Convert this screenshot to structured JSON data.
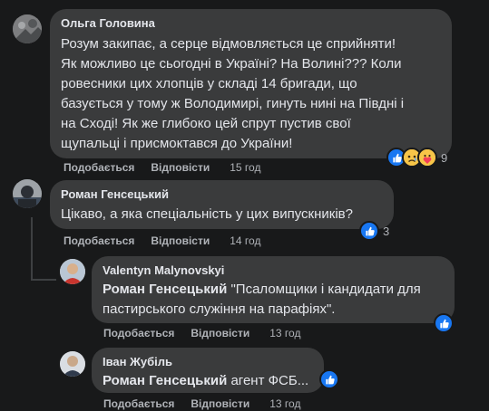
{
  "comments": [
    {
      "author": "Ольга Головина",
      "lines": [
        "Розум закипає, а серце відмовляється це сприйняти!",
        "Як можливо це сьогодні в Україні? На Волині??? Коли",
        "ровесники цих хлопців у складі 14 бригади, що",
        "базується у тому ж Володимирі, гинуть нині на Півдні і",
        "на Сході! Як же глибоко цей спрут пустив свої",
        "щупальці і присмоктався до України!"
      ],
      "like_label": "Подобається",
      "reply_label": "Відповісти",
      "time": "15 год",
      "reaction_count": "9"
    },
    {
      "author": "Роман Генсецький",
      "text": "Цікаво, а яка спеціальність у цих випускників?",
      "like_label": "Подобається",
      "reply_label": "Відповісти",
      "time": "14 год",
      "reaction_count": "3"
    },
    {
      "author": "Valentyn Malynovskyi",
      "mention": "Роман Генсецький",
      "text_line1": " \"Псаломщики і кандидати для",
      "text_line2": "пастирського служіння на парафіях\".",
      "like_label": "Подобається",
      "reply_label": "Відповісти",
      "time": "13 год"
    },
    {
      "author": "Іван Жубіль",
      "mention": "Роман Генсецький",
      "text": " агент ФСБ...",
      "like_label": "Подобається",
      "reply_label": "Відповісти",
      "time": "13 год"
    }
  ]
}
